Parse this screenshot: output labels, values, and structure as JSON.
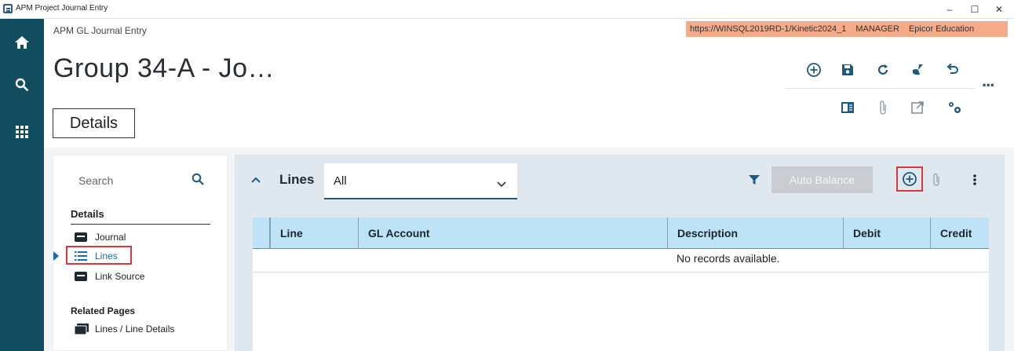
{
  "window": {
    "title": "APM Project Journal Entry",
    "controls": [
      "–",
      "☐",
      "✕"
    ]
  },
  "nav": {
    "icons": [
      "home-icon",
      "search-icon",
      "apps-grid-icon"
    ]
  },
  "header": {
    "breadcrumb": "APM GL Journal Entry",
    "env_url": "https://WINSQL2019RD-1/Kinetic2024_1",
    "env_user": "MANAGER",
    "env_company": "Epicor Education",
    "page_title": "Group 34-A - Jo…",
    "details_tab": "Details",
    "toolbar_icons": [
      "add-icon",
      "save-icon",
      "refresh-icon",
      "clear-icon",
      "undo-icon",
      "panel-icon",
      "attachment-icon",
      "open-external-icon",
      "settings-icon"
    ],
    "colors": {
      "accent": "#1e5a80",
      "env_banner": "#f4ab8a",
      "nav_bg": "#124c5f"
    }
  },
  "sidepanel": {
    "search_placeholder": "Search",
    "details_heading": "Details",
    "details_items": [
      {
        "label": "Journal",
        "icon": "card-icon"
      },
      {
        "label": "Lines",
        "icon": "list-icon",
        "active": true
      },
      {
        "label": "Link Source",
        "icon": "card-icon"
      }
    ],
    "related_heading": "Related Pages",
    "related_items": [
      {
        "label": "Lines / Line Details",
        "icon": "pages-icon"
      }
    ]
  },
  "lines": {
    "title": "Lines",
    "filter_value": "All",
    "auto_balance_label": "Auto Balance",
    "columns": [
      "Line",
      "GL Account",
      "Description",
      "Debit",
      "Credit"
    ],
    "empty_message": "No records available."
  }
}
